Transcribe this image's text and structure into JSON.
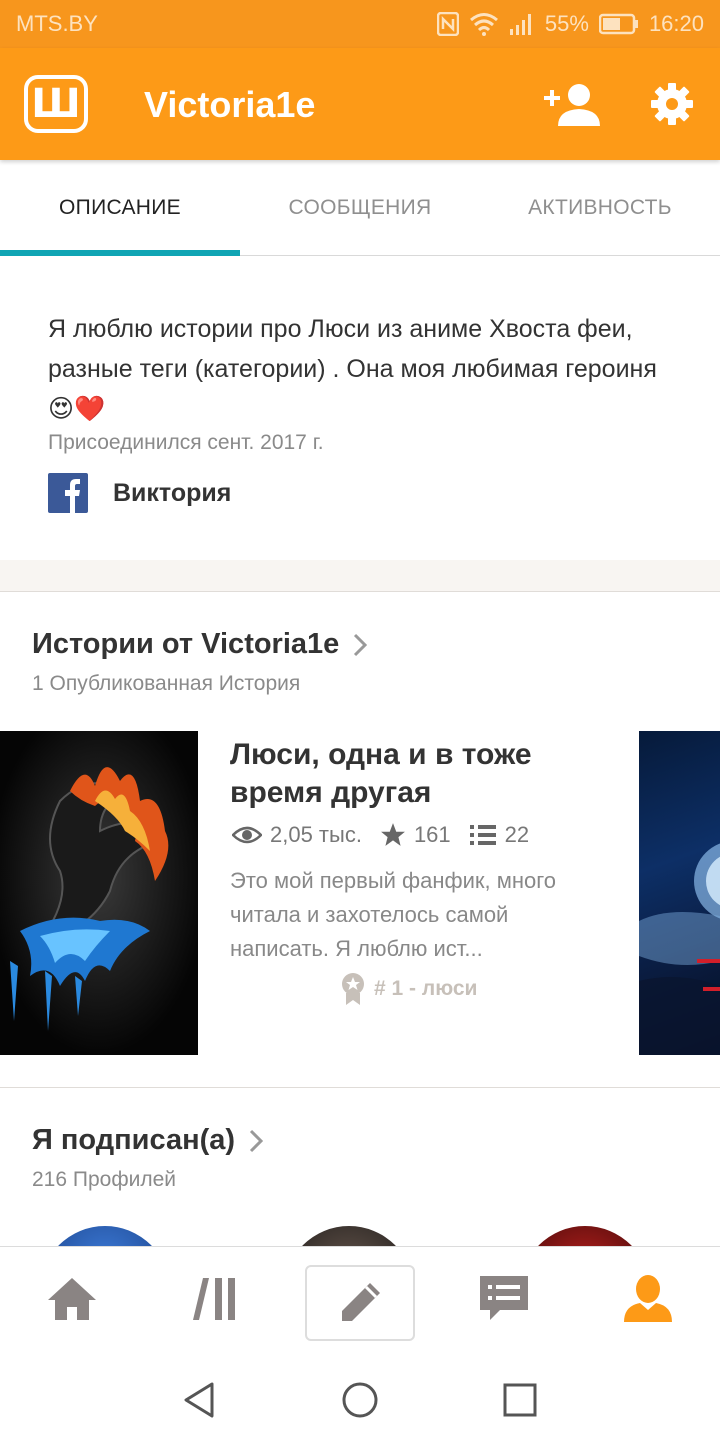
{
  "status_bar": {
    "carrier": "MTS.BY",
    "battery": "55%",
    "time": "16:20"
  },
  "app_bar": {
    "title": "Victoria1e",
    "logo_letter": "Ш"
  },
  "tabs": [
    {
      "label": "ОПИСАНИЕ",
      "active": true
    },
    {
      "label": "СООБЩЕНИЯ",
      "active": false
    },
    {
      "label": "АКТИВНОСТЬ",
      "active": false
    }
  ],
  "about": {
    "text": "Я люблю истории про Люси из аниме Хвоста феи, разные теги (категории) . Она моя любимая героиня😍❤️",
    "joined": "Присоединился сент. 2017 г.",
    "facebook_name": "Виктория"
  },
  "stories": {
    "title": "Истории от Victoria1e",
    "subtitle": "1 Опубликованная История",
    "items": [
      {
        "title": "Люси, одна и в тоже время другая",
        "reads": "2,05 тыс.",
        "votes": "161",
        "parts": "22",
        "description": "Это мой первый фанфик, много читала и захотелось самой написать. Я люблю ист...",
        "rank": "# 1 - люси"
      }
    ]
  },
  "following": {
    "title": "Я подписан(а)",
    "subtitle": "216 Профилей"
  },
  "colors": {
    "accent": "#fd9a17",
    "tab_indicator": "#10a5b4",
    "facebook": "#3b5998"
  }
}
